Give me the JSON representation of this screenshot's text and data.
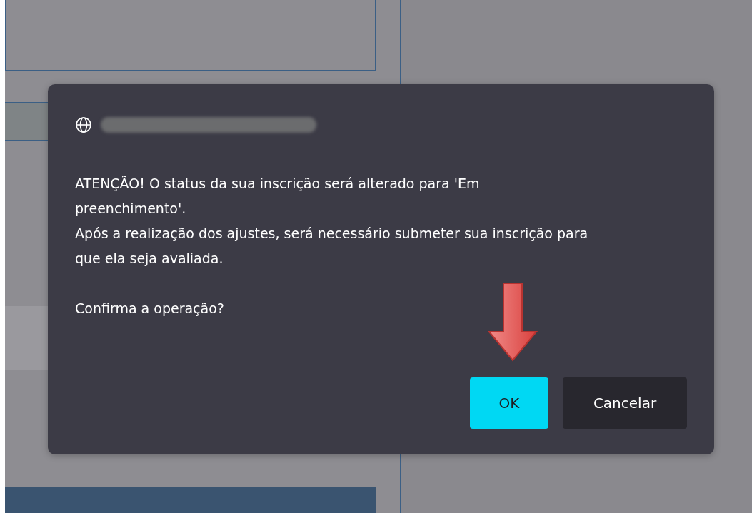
{
  "dialog": {
    "message": "ATENÇÃO! O status da sua inscrição será alterado para 'Em preenchimento'.\nApós a realização dos ajustes, será necessário submeter sua inscrição para que ela seja avaliada.\n\nConfirma a operação?",
    "buttons": [
      {
        "label": "OK",
        "kind": "primary"
      },
      {
        "label": "Cancelar",
        "kind": "secondary"
      }
    ]
  }
}
